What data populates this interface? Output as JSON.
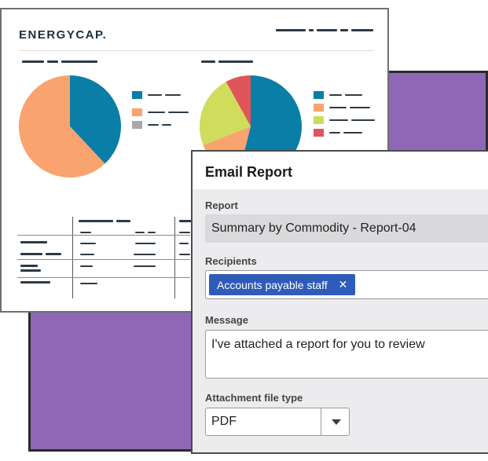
{
  "report_preview": {
    "logo_text": "ENERGYCAP.",
    "colors": {
      "blue": "#0a7ea6",
      "orange": "#f9a36e",
      "gray": "#a9a9a9",
      "yellow_green": "#cfdc5c",
      "red": "#e0555a"
    },
    "left_pie_fractions": {
      "blue": 0.38,
      "orange": 0.62
    },
    "right_pie_fractions": {
      "blue": 0.54,
      "orange": 0.15,
      "yellow_green": 0.23,
      "red": 0.08
    }
  },
  "email_dialog": {
    "title": "Email Report",
    "report_label": "Report",
    "report_value": "Summary by Commodity - Report-04",
    "recipients_label": "Recipients",
    "recipient_chip": "Accounts payable staff",
    "remove_icon": "close-icon",
    "message_label": "Message",
    "message_value": "I've attached a report for you to review",
    "attachment_label": "Attachment file type",
    "attachment_value": "PDF",
    "dropdown_icon": "caret-down-icon"
  }
}
